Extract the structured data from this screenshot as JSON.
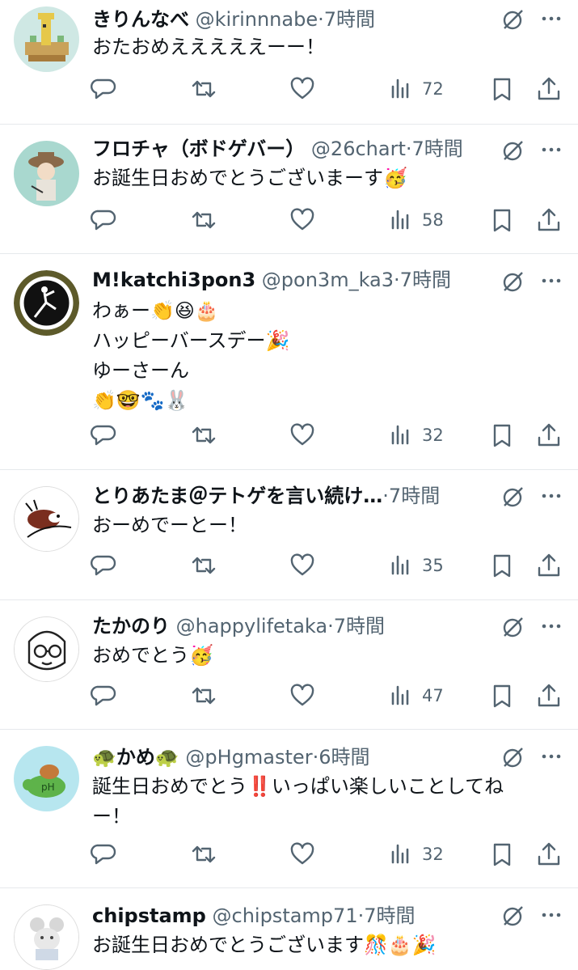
{
  "tweets": [
    {
      "name": "きりんなべ",
      "handle": "@kirinnnabe",
      "dot": "·",
      "time": "7時間",
      "lines": [
        "おたおめえええええーー！"
      ],
      "views": "72"
    },
    {
      "name": "フロチャ（ボドゲバー）",
      "handle": "@26chart",
      "dot": "·",
      "time": "7時間",
      "lines": [
        "お誕生日おめでとうございまーす🥳"
      ],
      "views": "58"
    },
    {
      "name": "M!katchi3pon3",
      "handle": "@pon3m_ka3",
      "dot": "·",
      "time": "7時間",
      "lines": [
        "わぁー👏😆🎂",
        "ハッピーバースデー🎉",
        "ゆーさーん",
        "👏🤓🐾🐰"
      ],
      "views": "32"
    },
    {
      "name": "とりあたま＠テトゲを言い続け…",
      "handle": "",
      "dot": "·",
      "time": "7時間",
      "lines": [
        "おーめでーとー！"
      ],
      "views": "35"
    },
    {
      "name": "たかのり",
      "handle": "@happylifetaka",
      "dot": "·",
      "time": "7時間",
      "lines": [
        "おめでとう🥳"
      ],
      "views": "47"
    },
    {
      "name": "🐢かめ🐢",
      "handle": "@pHgmaster",
      "dot": "·",
      "time": "6時間",
      "lines": [
        "誕生日おめでとう‼️いっぱい楽しいことしてね",
        "ー！"
      ],
      "views": "32"
    },
    {
      "name": "chipstamp",
      "handle": "@chipstamp71",
      "dot": "·",
      "time": "7時間",
      "lines": [
        "お誕生日おめでとうございます🎊🎂🎉"
      ],
      "views": ""
    }
  ],
  "icons": {
    "reply": "reply-icon",
    "retweet": "retweet-icon",
    "like": "like-icon",
    "views": "views-icon",
    "bookmark": "bookmark-icon",
    "share": "share-icon",
    "grok": "grok-icon",
    "more": "more-icon"
  },
  "colors": {
    "text": "#0f1419",
    "secondary": "#536471",
    "divider": "#e6e9ec"
  }
}
